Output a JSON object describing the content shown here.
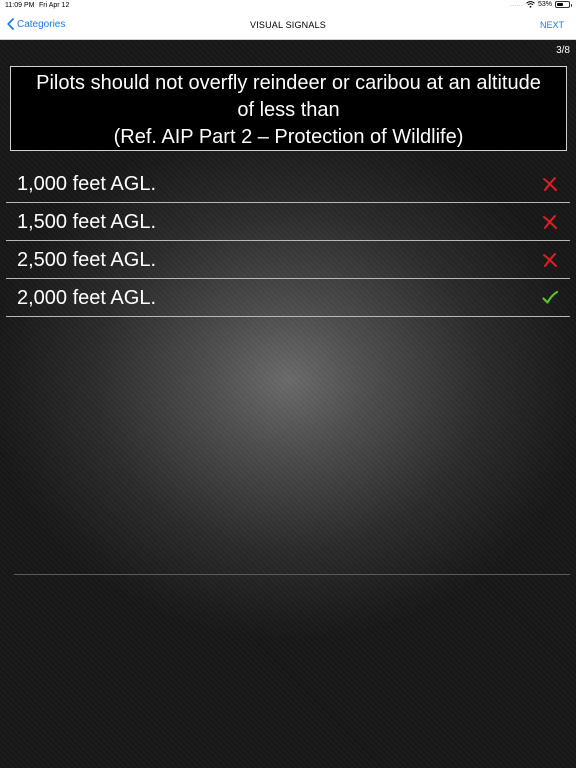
{
  "status_bar": {
    "time": "11:09 PM",
    "date": "Fri Apr 12",
    "signal": "......",
    "battery_percent": "53%",
    "battery_level": 0.53
  },
  "nav": {
    "back_label": "Categories",
    "title": "VISUAL SIGNALS",
    "next_label": "NEXT"
  },
  "quiz": {
    "progress": "3/8",
    "question_lines": [
      "Pilots should not overfly reindeer or caribou at an altitude",
      "of less than",
      "(Ref. AIP Part 2 – Protection of Wildlife)"
    ],
    "answers": [
      {
        "label": "1,000 feet AGL.",
        "result": "wrong"
      },
      {
        "label": "1,500 feet AGL.",
        "result": "wrong"
      },
      {
        "label": "2,500 feet AGL.",
        "result": "wrong"
      },
      {
        "label": "2,000 feet AGL.",
        "result": "correct"
      }
    ]
  },
  "colors": {
    "accent": "#1a7bf4",
    "wrong": "#e02020",
    "correct": "#5cc424"
  }
}
